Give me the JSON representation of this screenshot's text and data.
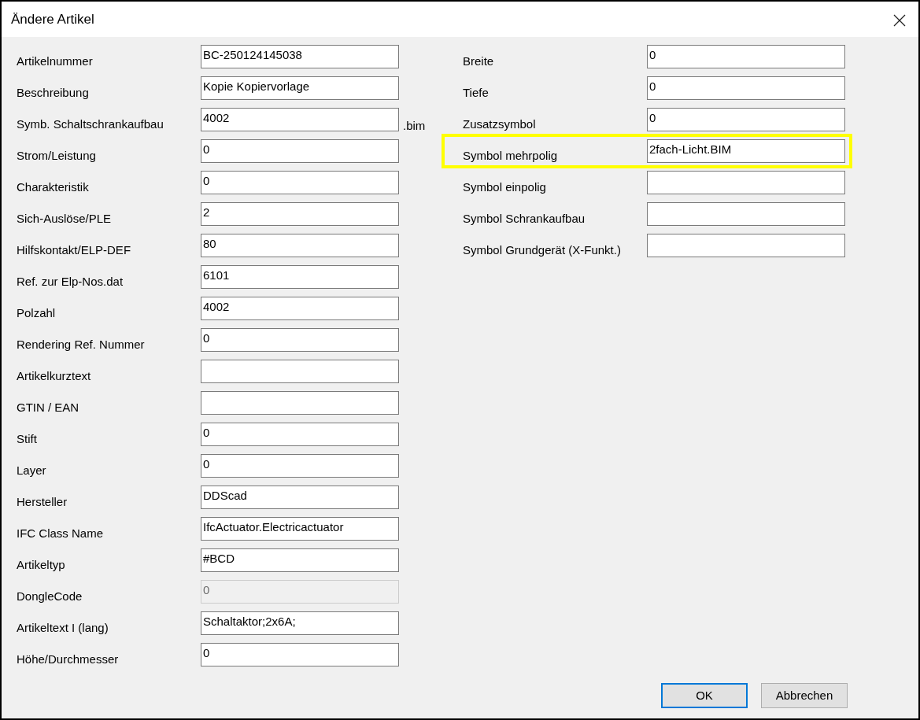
{
  "window": {
    "title": "Ändere Artikel"
  },
  "left_fields": [
    {
      "label": "Artikelnummer",
      "value": "BC-250124145038",
      "disabled": false
    },
    {
      "label": "Beschreibung",
      "value": "Kopie Kopiervorlage",
      "disabled": false
    },
    {
      "label": "Symb. Schaltschrankaufbau",
      "value": "4002",
      "disabled": false,
      "suffix": ".bim"
    },
    {
      "label": "Strom/Leistung",
      "value": "0",
      "disabled": false
    },
    {
      "label": "Charakteristik",
      "value": "0",
      "disabled": false
    },
    {
      "label": "Sich-Auslöse/PLE",
      "value": "2",
      "disabled": false
    },
    {
      "label": "Hilfskontakt/ELP-DEF",
      "value": "80",
      "disabled": false
    },
    {
      "label": "Ref. zur Elp-Nos.dat",
      "value": "6101",
      "disabled": false
    },
    {
      "label": "Polzahl",
      "value": "4002",
      "disabled": false
    },
    {
      "label": "Rendering Ref. Nummer",
      "value": "0",
      "disabled": false
    },
    {
      "label": "Artikelkurztext",
      "disabled": false
    },
    {
      "label": "GTIN / EAN",
      "disabled": false
    },
    {
      "label": "Stift",
      "value": "0",
      "disabled": false
    },
    {
      "label": "Layer",
      "value": "0",
      "disabled": false
    },
    {
      "label": "Hersteller",
      "value": "DDScad",
      "disabled": false
    },
    {
      "label": "IFC Class Name",
      "value": "IfcActuator.Electricactuator",
      "disabled": false
    },
    {
      "label": "Artikeltyp",
      "value": "#BCD",
      "disabled": false
    },
    {
      "label": "DongleCode",
      "value": "0",
      "disabled": true
    },
    {
      "label": "Artikeltext I (lang)",
      "value": "Schaltaktor;2x6A;",
      "disabled": false
    },
    {
      "label": "Höhe/Durchmesser",
      "value": "0",
      "disabled": false
    }
  ],
  "right_fields": [
    {
      "label": "Breite",
      "value": "0",
      "highlighted": false
    },
    {
      "label": "Tiefe",
      "value": "0",
      "highlighted": false
    },
    {
      "label": "Zusatzsymbol",
      "value": "0",
      "highlighted": false
    },
    {
      "label": "Symbol mehrpolig",
      "value": "2fach-Licht.BIM",
      "highlighted": true
    },
    {
      "label": "Symbol einpolig",
      "highlighted": false
    },
    {
      "label": "Symbol Schrankaufbau",
      "highlighted": false
    },
    {
      "label": "Symbol Grundgerät (X-Funkt.)",
      "highlighted": false
    }
  ],
  "buttons": [
    {
      "label": "OK",
      "default": true
    },
    {
      "label": "Abbrechen",
      "default": false
    }
  ]
}
